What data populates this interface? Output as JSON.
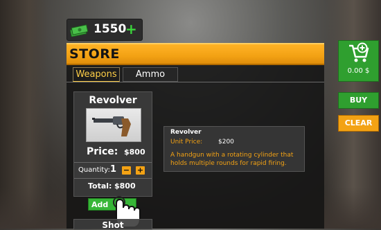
{
  "currency": {
    "amount": "1550",
    "add_symbol": "+"
  },
  "store": {
    "title": "STORE",
    "tabs": [
      {
        "label": "Weapons",
        "active": true
      },
      {
        "label": "Ammo",
        "active": false
      }
    ]
  },
  "item": {
    "name": "Revolver",
    "price_label": "Price:",
    "price": "$800",
    "quantity_label": "Quantity:",
    "quantity": "1",
    "minus_symbol": "−",
    "plus_symbol": "+",
    "total_label": "Total:",
    "total": "$800",
    "add_label": "Add"
  },
  "next_item": {
    "name": "Shot"
  },
  "description": {
    "name": "Revolver",
    "unit_price_label": "Unit Price:",
    "unit_price": "$200",
    "text": "A handgun with a rotating cylinder that holds multiple rounds for rapid firing."
  },
  "cart": {
    "total": "0.00 $",
    "icon": "cart-plus-icon"
  },
  "actions": {
    "buy_label": "BUY",
    "clear_label": "CLEAR"
  },
  "colors": {
    "accent": "#f3a214",
    "green": "#2f9f2f",
    "panel": "#141414"
  }
}
